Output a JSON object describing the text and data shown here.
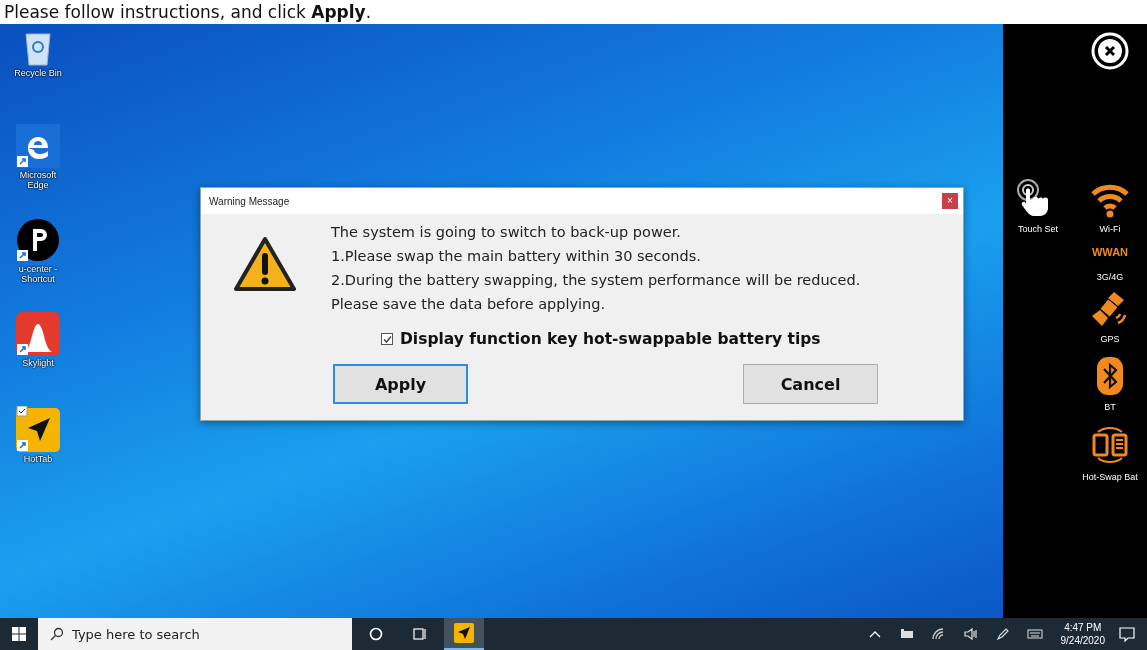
{
  "instruction": "Please follow instructions, and click **Apply**.",
  "desktop_icons": [
    {
      "label": "Recycle Bin",
      "kind": "recycle"
    },
    {
      "label": "Microsoft Edge",
      "kind": "edge"
    },
    {
      "label": "u-center - Shortcut",
      "kind": "ucenter"
    },
    {
      "label": "Skylight",
      "kind": "skylight"
    },
    {
      "label": "HotTab",
      "kind": "hottab"
    }
  ],
  "dialog": {
    "title": "Warning Message",
    "close": "×",
    "message_lines": [
      "The system is going to switch to back-up power.",
      "1.Please swap the main battery within 30 seconds.",
      "2.During the battery swapping, the system performance will be reduced.",
      "Please save the data before applying."
    ],
    "checkbox": {
      "label": "Display function key hot-swappable battery tips",
      "checked": true
    },
    "buttons": [
      {
        "label": "Apply",
        "selected": true
      },
      {
        "label": "Cancel",
        "selected": false
      }
    ]
  },
  "side_panel": {
    "items": [
      {
        "label": "Touch Set",
        "kind": "touch"
      },
      {
        "label": "Wi-Fi",
        "kind": "wifi"
      },
      {
        "label": "3G/4G",
        "kind": "wwan",
        "badge": "WWAN"
      },
      {
        "label": "GPS",
        "kind": "gps"
      },
      {
        "label": "BT",
        "kind": "bt"
      },
      {
        "label": "Hot-Swap Bat",
        "kind": "hotswap"
      }
    ]
  },
  "taskbar": {
    "search": {
      "placeholder": "Type here to search"
    },
    "pinned": [
      {
        "kind": "cortana",
        "selected": false
      },
      {
        "kind": "taskview",
        "selected": false
      },
      {
        "kind": "hottab",
        "selected": true
      }
    ],
    "tray": [
      {
        "kind": "chevron"
      },
      {
        "kind": "battery"
      },
      {
        "kind": "wifi"
      },
      {
        "kind": "volume"
      },
      {
        "kind": "pen"
      },
      {
        "kind": "keyboard"
      }
    ],
    "time": "4:47 PM",
    "date": "9/24/2020"
  }
}
